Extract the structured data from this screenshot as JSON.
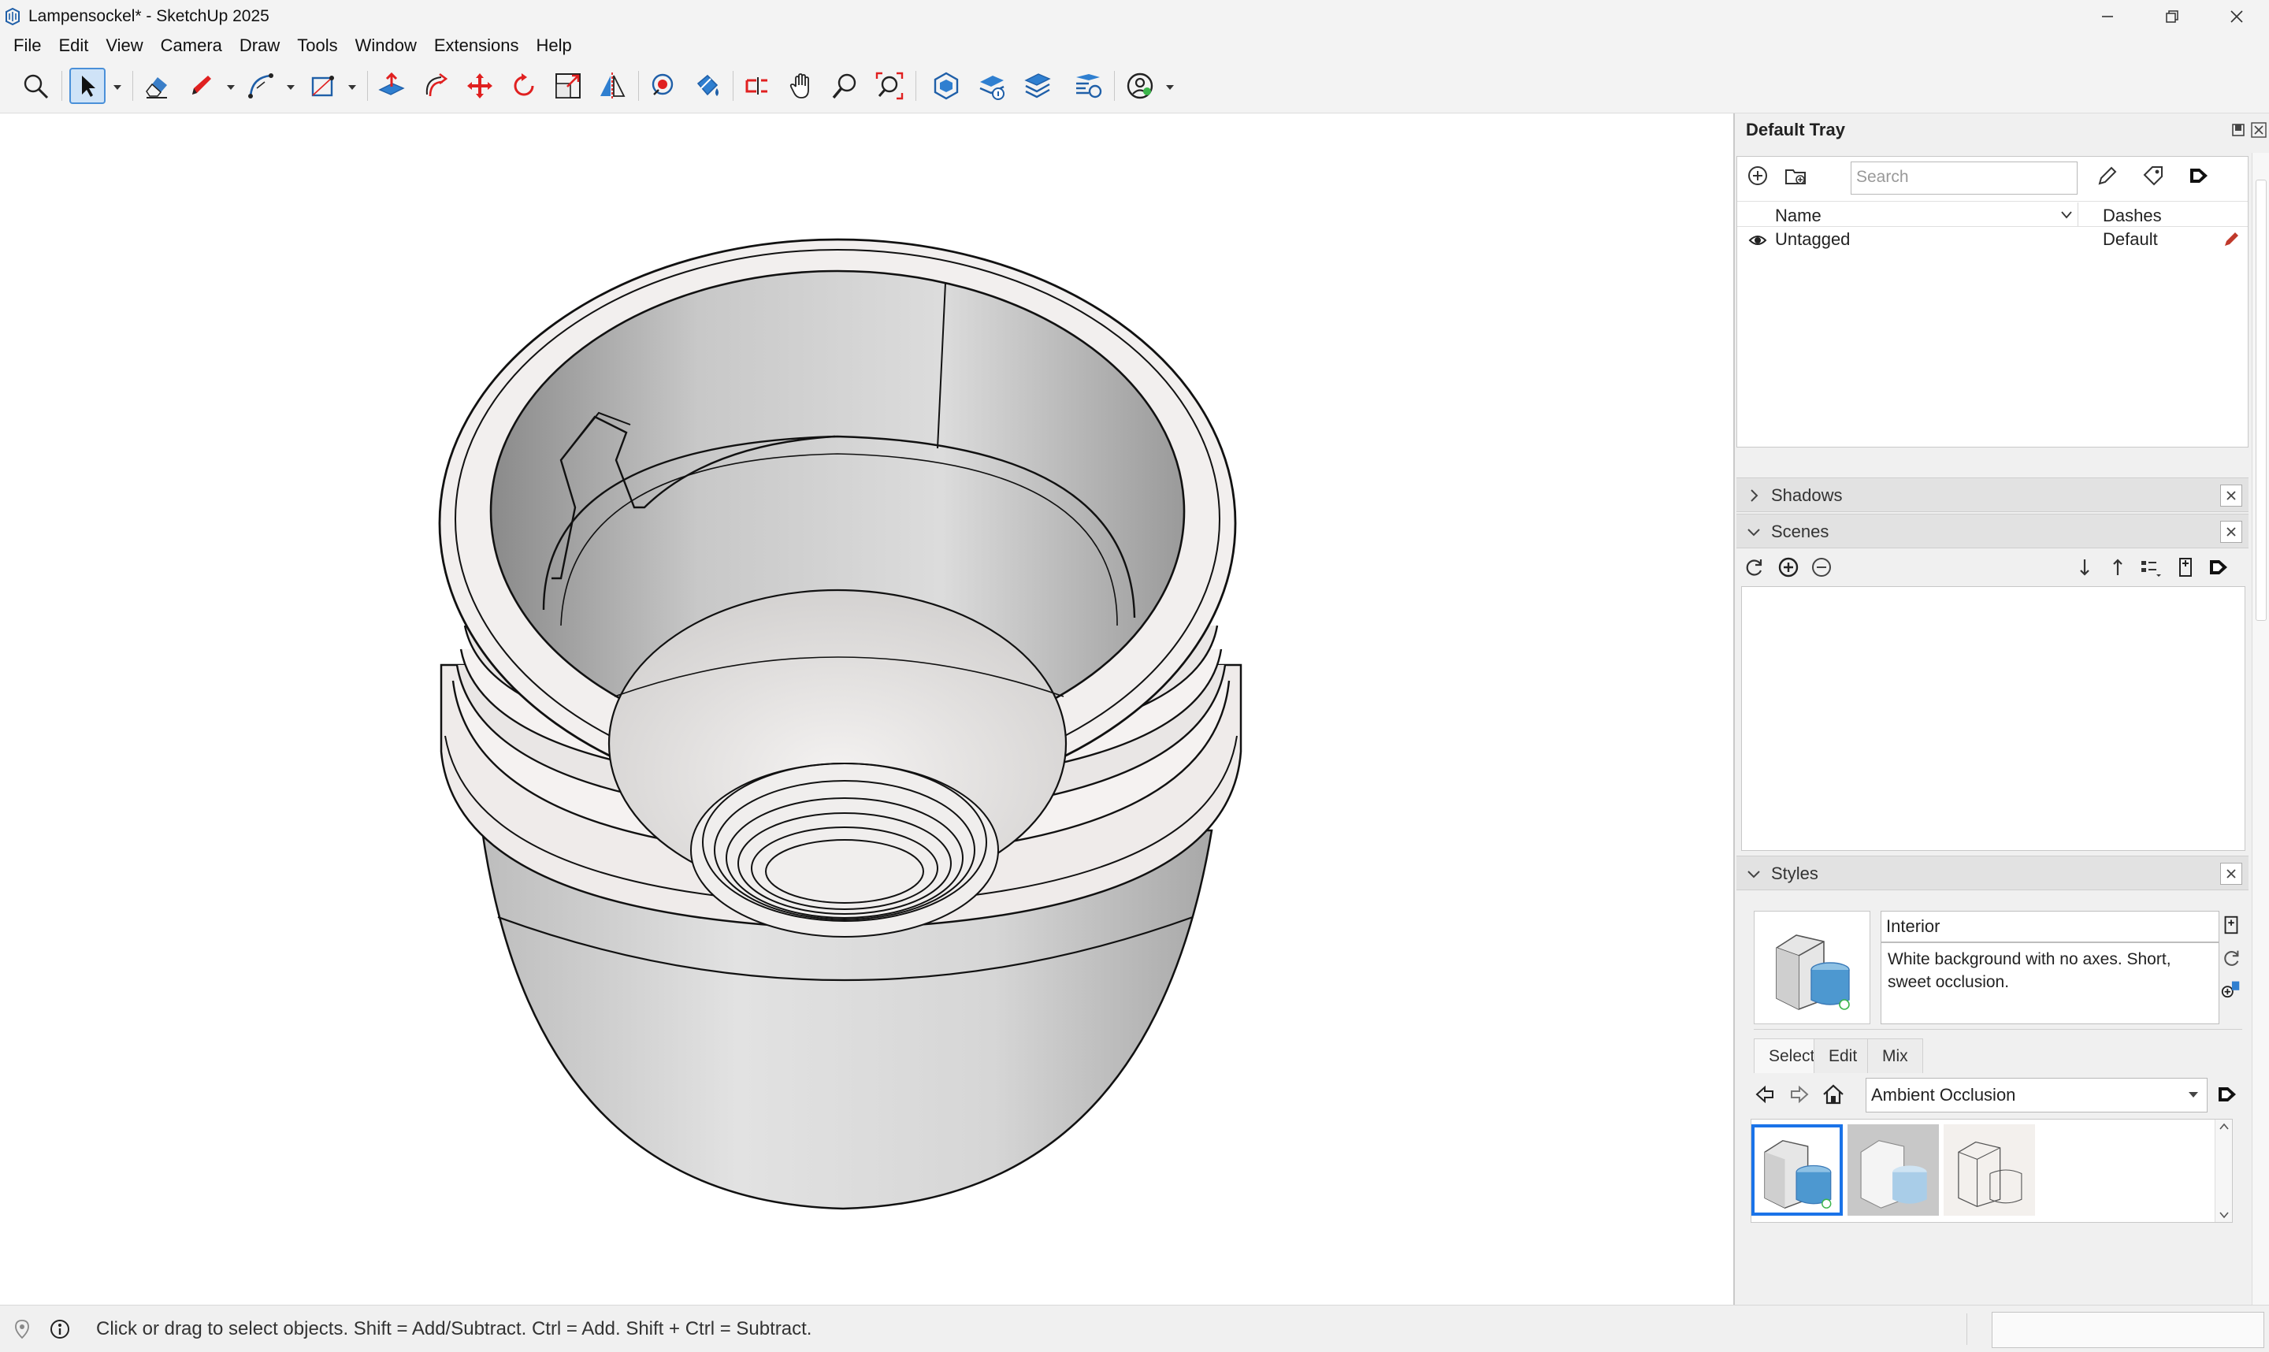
{
  "window": {
    "title": "Lampensockel* - SketchUp 2025",
    "minimize": "–",
    "maximize": "❐",
    "close": "✕"
  },
  "menu": [
    "File",
    "Edit",
    "View",
    "Camera",
    "Draw",
    "Tools",
    "Window",
    "Extensions",
    "Help"
  ],
  "toolbar": {
    "tools": [
      "search-icon",
      "select-icon",
      "eraser-icon",
      "pencil-icon",
      "arc-icon",
      "rectangle-icon",
      "push-pull-icon",
      "follow-me-icon",
      "move-icon",
      "rotate-icon",
      "scale-icon",
      "flip-icon",
      "paint-icon",
      "warehouse-icon",
      "section-icon",
      "pan-icon",
      "zoom-icon",
      "zoom-extents-icon",
      "solid-tools-icon",
      "model-info-icon",
      "tags-icon",
      "outliner-icon",
      "account-icon"
    ]
  },
  "tray": {
    "title": "Default Tray",
    "tags": {
      "search_placeholder": "Search",
      "col_name": "Name",
      "col_dashes": "Dashes",
      "rows": [
        {
          "name": "Untagged",
          "dashes": "Default"
        }
      ]
    },
    "shadows": {
      "label": "Shadows"
    },
    "scenes": {
      "label": "Scenes"
    },
    "styles": {
      "label": "Styles",
      "name": "Interior",
      "description": "White background with no axes. Short, sweet occlusion.",
      "tabs": [
        "Select",
        "Edit",
        "Mix"
      ],
      "collection": "Ambient Occlusion"
    }
  },
  "status": {
    "hint": "Click or drag to select objects. Shift = Add/Subtract. Ctrl = Add. Shift + Ctrl = Subtract."
  },
  "colors": {
    "accent": "#1a73e8",
    "toolbar_red": "#e02020",
    "toolbar_blue": "#1f5fa8"
  }
}
